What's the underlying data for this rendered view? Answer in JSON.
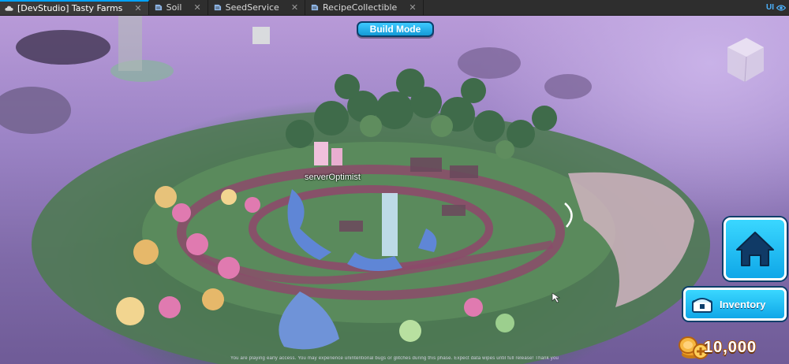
{
  "tabs": [
    {
      "label": "[DevStudio] Tasty Farms",
      "icon": "cloud-icon",
      "active": true
    },
    {
      "label": "Soil",
      "icon": "script-icon",
      "active": false
    },
    {
      "label": "SeedService",
      "icon": "script-icon",
      "active": false
    },
    {
      "label": "RecipeCollectible",
      "icon": "script-icon",
      "active": false
    }
  ],
  "toolbar": {
    "ui_label": "UI",
    "ui_icon": "eye-icon"
  },
  "game": {
    "build_mode_label": "Build Mode",
    "player_name": "serverOptimist",
    "home_icon": "home-icon",
    "inventory_label": "Inventory",
    "inventory_icon": "chest-icon",
    "coin_icon": "coin-icon",
    "coins": "10,000",
    "notice": "You are playing early access. You may experience unintentional bugs or glitches during this phase. Expect data wipes until full release! Thank you"
  },
  "colors": {
    "button_blue": "#149ad6",
    "button_border": "#0b3f6b",
    "coin_gold": "#f2a22a",
    "studio_tab_accent": "#00a2ff"
  }
}
